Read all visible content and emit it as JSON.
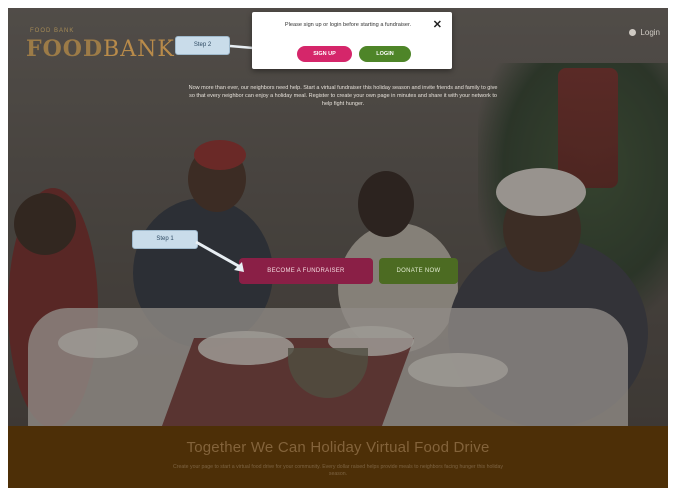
{
  "brand": {
    "logo_small_text": "FOOD BANK",
    "logo_word": "FOOD",
    "logo_word_accent": "BANK",
    "login_link": "Login"
  },
  "hero": {
    "intro_text": "Now more than ever, our neighbors need help. Start a virtual fundraiser this holiday season and invite friends and family to give so that every neighbor can enjoy a holiday meal. Register to create your own page in minutes and share it with your network to help fight hunger.",
    "fundraiser_button": "BECOME A FUNDRAISER",
    "donate_button": "DONATE NOW"
  },
  "callouts": {
    "step1": "Step 1",
    "step2": "Step 2"
  },
  "modal": {
    "message": "Please sign up or login before starting a fundraiser.",
    "close_label": "✕",
    "signup_button": "SIGN UP",
    "login_button": "LOGIN"
  },
  "footer_band": {
    "title": "Together We Can Holiday Virtual Food Drive",
    "subtitle": "Create your page to start a virtual food drive for your community. Every dollar raised helps provide meals to neighbors facing hunger this holiday season."
  },
  "colors": {
    "fundraiser_button": "#8a1f46",
    "donate_button": "#4c6b22",
    "signup_button": "#d5266a",
    "login_button": "#4e8528",
    "footer_band": "#4d2f07",
    "callout": "#c9dcea"
  }
}
